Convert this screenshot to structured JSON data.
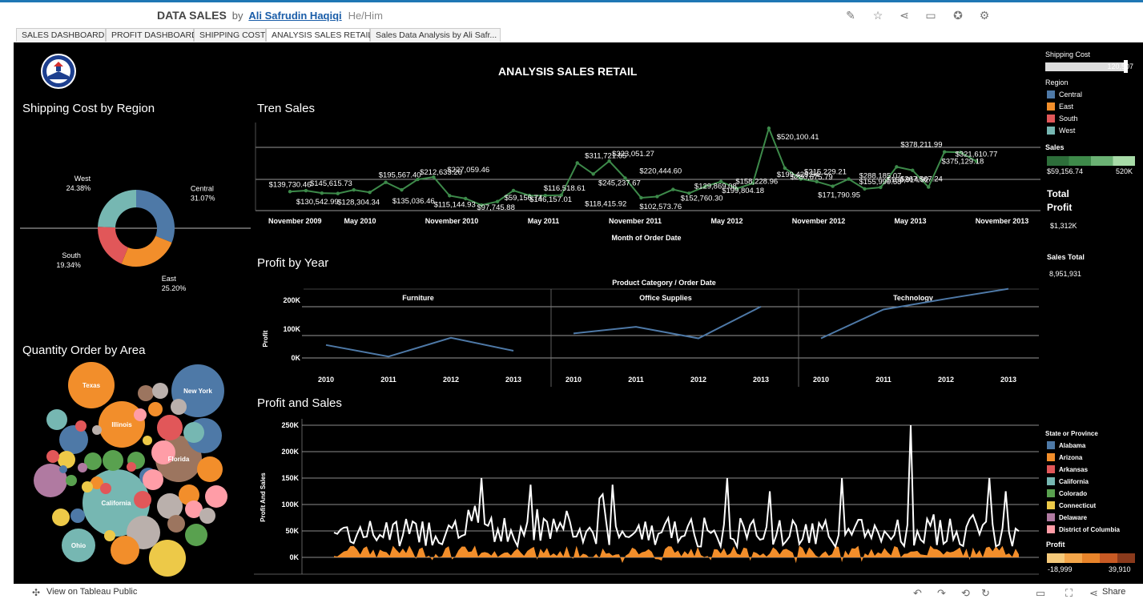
{
  "header": {
    "workbook": "DATA SALES",
    "by": "by",
    "author": "Ali Safrudin Haqiqi",
    "pronoun": "He/Him",
    "icons": [
      "edit-icon",
      "star-icon",
      "share-icon",
      "comment-icon",
      "badge-icon",
      "gear-icon"
    ]
  },
  "tabs": [
    "SALES DASHBOARD",
    "PROFIT DASHBOARD",
    "SHIPPING COST",
    "ANALYSIS SALES RETAIL",
    "Sales Data Analysis by Ali Safr..."
  ],
  "dashboard": {
    "title": "ANALYSIS SALES RETAIL",
    "shipping_by_region_title": "Shipping Cost by Region",
    "quantity_by_area_title": "Quantity Order by Area",
    "tren_sales_title": "Tren Sales",
    "profit_by_year_title": "Profit by Year",
    "profit_and_sales_title": "Profit and Sales"
  },
  "side_panel": {
    "shipping_cost_label": "Shipping Cost",
    "shipping_cost_value": "120,507",
    "region_label": "Region",
    "regions": [
      {
        "name": "Central",
        "color": "#4e79a7"
      },
      {
        "name": "East",
        "color": "#f28e2b"
      },
      {
        "name": "South",
        "color": "#e15759"
      },
      {
        "name": "West",
        "color": "#76b7b2"
      }
    ],
    "sales_label": "Sales",
    "sales_min": "$59,156.74",
    "sales_max": "520K",
    "total_profit_label_1": "Total",
    "total_profit_label_2": "Profit",
    "total_profit_value": "$1,312K",
    "sales_total_label": "Sales Total",
    "sales_total_value": "8,951,931",
    "state_label": "State or Province",
    "states": [
      {
        "name": "Alabama",
        "color": "#4e79a7"
      },
      {
        "name": "Arizona",
        "color": "#f28e2b"
      },
      {
        "name": "Arkansas",
        "color": "#e15759"
      },
      {
        "name": "California",
        "color": "#76b7b2"
      },
      {
        "name": "Colorado",
        "color": "#59a14f"
      },
      {
        "name": "Connecticut",
        "color": "#edc948"
      },
      {
        "name": "Delaware",
        "color": "#b07aa1"
      },
      {
        "name": "District of Columbia",
        "color": "#ff9da7"
      }
    ],
    "profit_label": "Profit",
    "profit_min": "-18,999",
    "profit_max": "39,910"
  },
  "footer": {
    "view_label": "View on Tableau Public",
    "share_label": "Share"
  },
  "chart_data": [
    {
      "type": "pie",
      "title": "Shipping Cost by Region",
      "categories": [
        "Central",
        "East",
        "South",
        "West"
      ],
      "values": [
        31.07,
        25.2,
        19.34,
        24.38
      ],
      "labels": [
        "31.07%",
        "25.20%",
        "19.34%",
        "24.38%"
      ],
      "colors": [
        "#4e79a7",
        "#f28e2b",
        "#e15759",
        "#76b7b2"
      ]
    },
    {
      "type": "line",
      "title": "Tren Sales",
      "xlabel": "Month of Order Date",
      "x_ticks": [
        "November 2009",
        "May 2010",
        "November 2010",
        "May 2011",
        "November 2011",
        "May 2012",
        "November 2012",
        "May 2013",
        "November 2013"
      ],
      "labeled_points": [
        {
          "x": "2009-10",
          "y": 139730.46,
          "label": "$139,730.46"
        },
        {
          "x": "2009-12",
          "y": 130542.99,
          "label": "$130,542.99"
        },
        {
          "x": "2010-01",
          "y": 145615.73,
          "label": "$145,615.73"
        },
        {
          "x": "2010-03",
          "y": 128304.34,
          "label": "$128,304.34"
        },
        {
          "x": "2010-06",
          "y": 195567.4,
          "label": "$195,567.40"
        },
        {
          "x": "2010-07",
          "y": 135036.46,
          "label": "$135,036.46"
        },
        {
          "x": "2010-09",
          "y": 212633.26,
          "label": "$212,633.26"
        },
        {
          "x": "2010-10",
          "y": 115144.93,
          "label": "$115,144.93"
        },
        {
          "x": "2010-11",
          "y": 227059.46,
          "label": "$227,059.46"
        },
        {
          "x": "2011-01",
          "y": 97745.88,
          "label": "$97,745.88"
        },
        {
          "x": "2011-03",
          "y": 59156.74,
          "label": "$59,156.74"
        },
        {
          "x": "2011-05",
          "y": 146157.01,
          "label": "$146,157.01"
        },
        {
          "x": "2011-06",
          "y": 116518.61,
          "label": "$116,518.61"
        },
        {
          "x": "2011-09",
          "y": 118415.92,
          "label": "$118,415.92"
        },
        {
          "x": "2011-09",
          "y": 311721.65,
          "label": "$311,721.65"
        },
        {
          "x": "2011-10",
          "y": 245237.67,
          "label": "$245,237.67"
        },
        {
          "x": "2011-11",
          "y": 323051.27,
          "label": "$323,051.27"
        },
        {
          "x": "2012-01",
          "y": 102573.76,
          "label": "$102,573.76"
        },
        {
          "x": "2012-01",
          "y": 220444.6,
          "label": "$220,444.60"
        },
        {
          "x": "2012-04",
          "y": 152760.3,
          "label": "$152,760.30"
        },
        {
          "x": "2012-05",
          "y": 129869.08,
          "label": "$129,869.08"
        },
        {
          "x": "2012-07",
          "y": 199804.18,
          "label": "$199,804.18"
        },
        {
          "x": "2012-08",
          "y": 158228.96,
          "label": "$158,228.96"
        },
        {
          "x": "2012-11",
          "y": 520100.41,
          "label": "$520,100.41"
        },
        {
          "x": "2012-11",
          "y": 199429.54,
          "label": "$199,429.54"
        },
        {
          "x": "2012-12",
          "y": 280675.79,
          "label": "$280,675.79"
        },
        {
          "x": "2013-01",
          "y": 215229.21,
          "label": "$215,229.21"
        },
        {
          "x": "2013-02",
          "y": 171790.95,
          "label": "$171,790.95"
        },
        {
          "x": "2013-05",
          "y": 155990.53,
          "label": "$155,990.53"
        },
        {
          "x": "2013-05",
          "y": 288185.07,
          "label": "$288,185.07"
        },
        {
          "x": "2013-07",
          "y": 166914.92,
          "label": "$166,914.92"
        },
        {
          "x": "2013-08",
          "y": 267567.24,
          "label": "$267,567.24"
        },
        {
          "x": "2013-08",
          "y": 378211.99,
          "label": "$378,211.99"
        },
        {
          "x": "2013-11",
          "y": 375129.18,
          "label": "$375,129.18"
        },
        {
          "x": "2013-12",
          "y": 321610.77,
          "label": "$321,610.77"
        }
      ],
      "series": [
        {
          "values": [
            139730,
            145615,
            130543,
            128304,
            150000,
            135036,
            195567,
            150000,
            212633,
            227059,
            115145,
            97746,
            59157,
            80000,
            146157,
            116519,
            116000,
            118416,
            311722,
            245238,
            323051,
            220445,
            102574,
            110000,
            152760,
            129869,
            170000,
            199804,
            158229,
            190000,
            520100,
            280676,
            215229,
            199430,
            171791,
            215000,
            155991,
            165000,
            288185,
            267567,
            166915,
            378212,
            375129,
            321611
          ]
        }
      ],
      "color": "#3d8a4a"
    },
    {
      "type": "line",
      "title": "Profit by Year",
      "xlabel": "Product Category / Order Date",
      "ylabel": "Profit",
      "y_ticks": [
        "0K",
        "100K",
        "200K"
      ],
      "panels": [
        {
          "name": "Furniture",
          "x": [
            "2010",
            "2011",
            "2012",
            "2013"
          ],
          "values": [
            45000,
            5000,
            70000,
            25000
          ]
        },
        {
          "name": "Office Supplies",
          "x": [
            "2010",
            "2011",
            "2012",
            "2013"
          ],
          "values": [
            85000,
            108000,
            68000,
            178000
          ]
        },
        {
          "name": "Technology",
          "x": [
            "2010",
            "2011",
            "2012",
            "2013"
          ],
          "values": [
            68000,
            168000,
            205000,
            240000
          ]
        }
      ],
      "color": "#4e79a7"
    },
    {
      "type": "area",
      "title": "Profit and Sales",
      "ylabel": "Profit And Sales",
      "y_ticks": [
        "0K",
        "50K",
        "100K",
        "150K",
        "200K",
        "250K"
      ],
      "series": [
        {
          "name": "Sales",
          "peak": 254000,
          "color": "#ffffff"
        },
        {
          "name": "Profit",
          "min": -18999,
          "max": 39910,
          "color": "#f28e2b"
        }
      ]
    },
    {
      "type": "scatter",
      "title": "Quantity Order by Area",
      "labeled_bubbles": [
        "Texas",
        "New York",
        "Illinois",
        "Florida",
        "California",
        "Ohio"
      ]
    }
  ]
}
